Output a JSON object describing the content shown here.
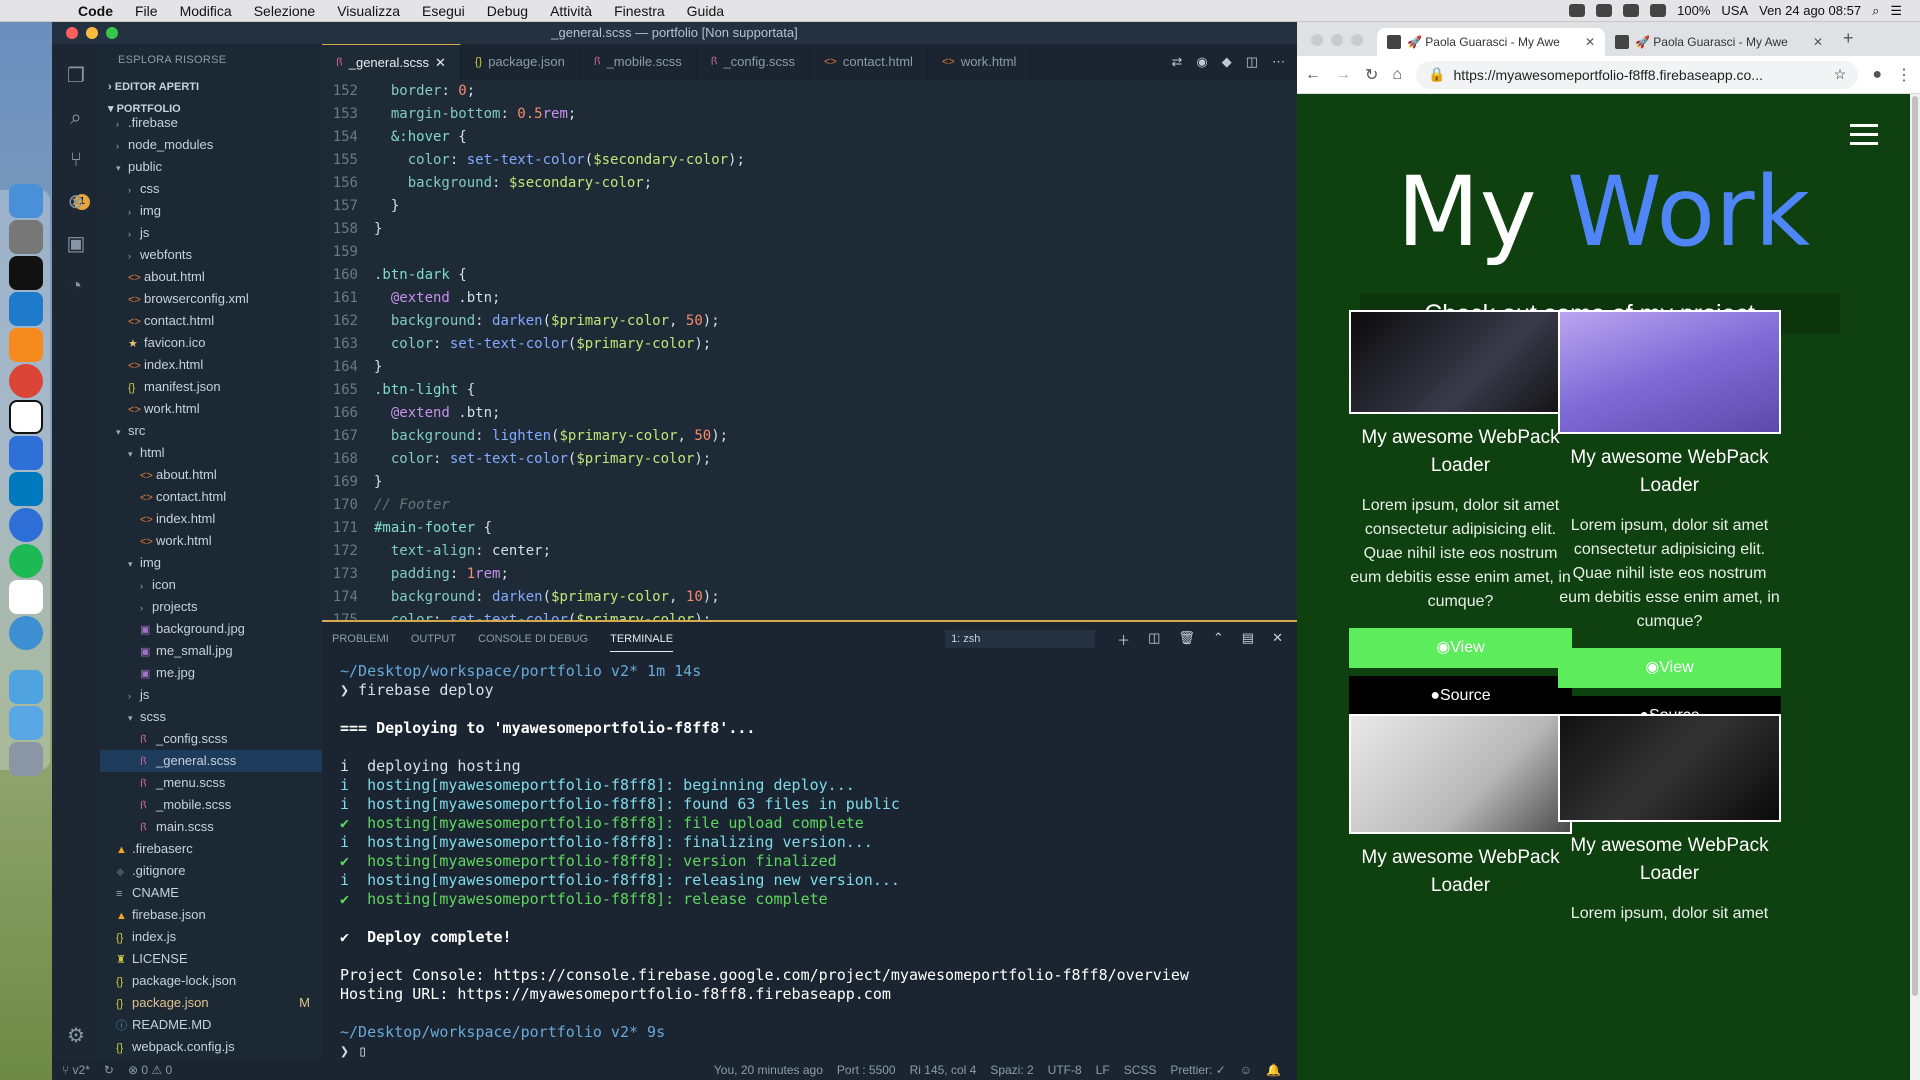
{
  "menubar": {
    "app": "Code",
    "items": [
      "File",
      "Modifica",
      "Selezione",
      "Visualizza",
      "Esegui",
      "Debug",
      "Attività",
      "Finestra",
      "Guida"
    ],
    "battery": "100%",
    "locale": "USA",
    "datetime": "Ven 24 ago 08:57"
  },
  "vscode": {
    "title": "_general.scss — portfolio [Non supportata]",
    "badge": "1",
    "explorer": {
      "title": "ESPLORA RISORSE",
      "open_editors": "EDITOR APERTI",
      "root": "PORTFOLIO",
      "tree": [
        {
          "label": ".firebase",
          "depth": 1,
          "type": "dir",
          "open": false
        },
        {
          "label": "node_modules",
          "depth": 1,
          "type": "dir",
          "open": false
        },
        {
          "label": "public",
          "depth": 1,
          "type": "dir",
          "open": true
        },
        {
          "label": "css",
          "depth": 2,
          "type": "dir",
          "open": false
        },
        {
          "label": "img",
          "depth": 2,
          "type": "dir",
          "open": false
        },
        {
          "label": "js",
          "depth": 2,
          "type": "dir",
          "open": false
        },
        {
          "label": "webfonts",
          "depth": 2,
          "type": "dir",
          "open": false
        },
        {
          "label": "about.html",
          "depth": 2,
          "type": "html"
        },
        {
          "label": "browserconfig.xml",
          "depth": 2,
          "type": "xml"
        },
        {
          "label": "contact.html",
          "depth": 2,
          "type": "html"
        },
        {
          "label": "favicon.ico",
          "depth": 2,
          "type": "ico"
        },
        {
          "label": "index.html",
          "depth": 2,
          "type": "html"
        },
        {
          "label": "manifest.json",
          "depth": 2,
          "type": "json"
        },
        {
          "label": "work.html",
          "depth": 2,
          "type": "html"
        },
        {
          "label": "src",
          "depth": 1,
          "type": "dir",
          "open": true
        },
        {
          "label": "html",
          "depth": 2,
          "type": "dir",
          "open": true
        },
        {
          "label": "about.html",
          "depth": 3,
          "type": "html"
        },
        {
          "label": "contact.html",
          "depth": 3,
          "type": "html"
        },
        {
          "label": "index.html",
          "depth": 3,
          "type": "html"
        },
        {
          "label": "work.html",
          "depth": 3,
          "type": "html"
        },
        {
          "label": "img",
          "depth": 2,
          "type": "dir",
          "open": true
        },
        {
          "label": "icon",
          "depth": 3,
          "type": "dir",
          "open": false
        },
        {
          "label": "projects",
          "depth": 3,
          "type": "dir",
          "open": false
        },
        {
          "label": "background.jpg",
          "depth": 3,
          "type": "img"
        },
        {
          "label": "me_small.jpg",
          "depth": 3,
          "type": "img"
        },
        {
          "label": "me.jpg",
          "depth": 3,
          "type": "img"
        },
        {
          "label": "js",
          "depth": 2,
          "type": "dir",
          "open": false
        },
        {
          "label": "scss",
          "depth": 2,
          "type": "dir",
          "open": true
        },
        {
          "label": "_config.scss",
          "depth": 3,
          "type": "scss"
        },
        {
          "label": "_general.scss",
          "depth": 3,
          "type": "scss",
          "selected": true
        },
        {
          "label": "_menu.scss",
          "depth": 3,
          "type": "scss"
        },
        {
          "label": "_mobile.scss",
          "depth": 3,
          "type": "scss"
        },
        {
          "label": "main.scss",
          "depth": 3,
          "type": "scss"
        },
        {
          "label": ".firebaserc",
          "depth": 1,
          "type": "fb"
        },
        {
          "label": ".gitignore",
          "depth": 1,
          "type": "git"
        },
        {
          "label": "CNAME",
          "depth": 1,
          "type": "txt"
        },
        {
          "label": "firebase.json",
          "depth": 1,
          "type": "fb"
        },
        {
          "label": "index.js",
          "depth": 1,
          "type": "js"
        },
        {
          "label": "LICENSE",
          "depth": 1,
          "type": "lic"
        },
        {
          "label": "package-lock.json",
          "depth": 1,
          "type": "json"
        },
        {
          "label": "package.json",
          "depth": 1,
          "type": "json",
          "modified": "M"
        },
        {
          "label": "README.MD",
          "depth": 1,
          "type": "md"
        },
        {
          "label": "webpack.config.js",
          "depth": 1,
          "type": "js"
        }
      ]
    },
    "tabs": [
      {
        "label": "_general.scss",
        "icon": "scss",
        "active": true
      },
      {
        "label": "package.json",
        "icon": "json"
      },
      {
        "label": "_mobile.scss",
        "icon": "scss"
      },
      {
        "label": "_config.scss",
        "icon": "scss"
      },
      {
        "label": "contact.html",
        "icon": "html"
      },
      {
        "label": "work.html",
        "icon": "html"
      }
    ],
    "code": [
      {
        "n": "152",
        "t": "  border: 0;"
      },
      {
        "n": "153",
        "t": "  margin-bottom: 0.5rem;"
      },
      {
        "n": "154",
        "t": "  &:hover {"
      },
      {
        "n": "155",
        "t": "    color: set-text-color($secondary-color);"
      },
      {
        "n": "156",
        "t": "    background: $secondary-color;"
      },
      {
        "n": "157",
        "t": "  }"
      },
      {
        "n": "158",
        "t": "}"
      },
      {
        "n": "159",
        "t": ""
      },
      {
        "n": "160",
        "t": ".btn-dark {"
      },
      {
        "n": "161",
        "t": "  @extend .btn;"
      },
      {
        "n": "162",
        "t": "  background: darken($primary-color, 50);"
      },
      {
        "n": "163",
        "t": "  color: set-text-color($primary-color);"
      },
      {
        "n": "164",
        "t": "}"
      },
      {
        "n": "165",
        "t": ".btn-light {"
      },
      {
        "n": "166",
        "t": "  @extend .btn;"
      },
      {
        "n": "167",
        "t": "  background: lighten($primary-color, 50);"
      },
      {
        "n": "168",
        "t": "  color: set-text-color($primary-color);"
      },
      {
        "n": "169",
        "t": "}"
      },
      {
        "n": "170",
        "t": "// Footer"
      },
      {
        "n": "171",
        "t": "#main-footer {"
      },
      {
        "n": "172",
        "t": "  text-align: center;"
      },
      {
        "n": "173",
        "t": "  padding: 1rem;"
      },
      {
        "n": "174",
        "t": "  background: darken($primary-color, 10);"
      },
      {
        "n": "175",
        "t": "  color: set-text-color($primary-color);"
      }
    ],
    "panel": {
      "tabs": [
        "PROBLEMI",
        "OUTPUT",
        "CONSOLE DI DEBUG",
        "TERMINALE"
      ],
      "active": "TERMINALE",
      "shell": "1: zsh"
    },
    "terminal": [
      {
        "t": "~/Desktop/workspace/portfolio v2* 1m 14s",
        "c": "#6aa8d8"
      },
      {
        "t": "❯ firebase deploy",
        "c": "#d6deeb"
      },
      {
        "t": "",
        "c": "#d6deeb"
      },
      {
        "t": "=== Deploying to 'myawesomeportfolio-f8ff8'...",
        "c": "#ffffff",
        "b": true
      },
      {
        "t": "",
        "c": "#d6deeb"
      },
      {
        "t": "i  deploying hosting",
        "c": "#d6deeb"
      },
      {
        "t": "i  hosting[myawesomeportfolio-f8ff8]: beginning deploy...",
        "c": "#7fdbe9"
      },
      {
        "t": "i  hosting[myawesomeportfolio-f8ff8]: found 63 files in public",
        "c": "#7fdbe9"
      },
      {
        "t": "✔  hosting[myawesomeportfolio-f8ff8]: file upload complete",
        "c": "#5fd65f"
      },
      {
        "t": "i  hosting[myawesomeportfolio-f8ff8]: finalizing version...",
        "c": "#7fdbe9"
      },
      {
        "t": "✔  hosting[myawesomeportfolio-f8ff8]: version finalized",
        "c": "#5fd65f"
      },
      {
        "t": "i  hosting[myawesomeportfolio-f8ff8]: releasing new version...",
        "c": "#7fdbe9"
      },
      {
        "t": "✔  hosting[myawesomeportfolio-f8ff8]: release complete",
        "c": "#5fd65f"
      },
      {
        "t": "",
        "c": "#d6deeb"
      },
      {
        "t": "✔  Deploy complete!",
        "c": "#ffffff",
        "b": true
      },
      {
        "t": "",
        "c": "#d6deeb"
      },
      {
        "t": "Project Console: https://console.firebase.google.com/project/myawesomeportfolio-f8ff8/overview",
        "c": "#ffffff"
      },
      {
        "t": "Hosting URL: https://myawesomeportfolio-f8ff8.firebaseapp.com",
        "c": "#ffffff"
      },
      {
        "t": "",
        "c": "#d6deeb"
      },
      {
        "t": "~/Desktop/workspace/portfolio v2* 9s",
        "c": "#6aa8d8"
      },
      {
        "t": "❯ ▯",
        "c": "#d6deeb"
      }
    ],
    "status": {
      "branch": "v2*",
      "errors": "0",
      "warnings": "0",
      "blame": "You, 20 minutes ago",
      "port": "Port : 5500",
      "cursor": "Ri 145, col 4",
      "spaces": "Spazi: 2",
      "encoding": "UTF-8",
      "eol": "LF",
      "lang": "SCSS",
      "prettier": "Prettier: ✓"
    }
  },
  "chrome": {
    "tabs": [
      {
        "label": "🚀 Paola Guarasci - My Awe",
        "active": true
      },
      {
        "label": "🚀 Paola Guarasci - My Awe",
        "active": false
      }
    ],
    "url": "https://myawesomeportfolio-f8ff8.firebaseapp.co..."
  },
  "site": {
    "title_a": "My",
    "title_b": "Work",
    "subtitle": "Check out some of my project...",
    "cards": [
      {
        "title": "My awesome WebPack Loader",
        "desc": "Lorem ipsum, dolor sit amet consectetur adipisicing elit. Quae nihil iste eos nostrum eum debitis esse enim amet, in cumque?",
        "view": "View",
        "source": "Source"
      },
      {
        "title": "My awesome WebPack Loader",
        "desc": "Lorem ipsum, dolor sit amet consectetur adipisicing elit. Quae nihil iste eos nostrum eum debitis esse enim amet, in cumque?",
        "view": "View",
        "source": "Source"
      },
      {
        "title": "My awesome WebPack Loader",
        "desc": "",
        "view": "",
        "source": ""
      },
      {
        "title": "My awesome WebPack Loader",
        "desc": "Lorem ipsum, dolor sit amet",
        "view": "",
        "source": ""
      }
    ]
  },
  "colors": {
    "accent": "#4f86f7",
    "site_bg": "#0f400f",
    "btn_view": "#5cec5c",
    "tab_active_border": "#d7a94d"
  }
}
